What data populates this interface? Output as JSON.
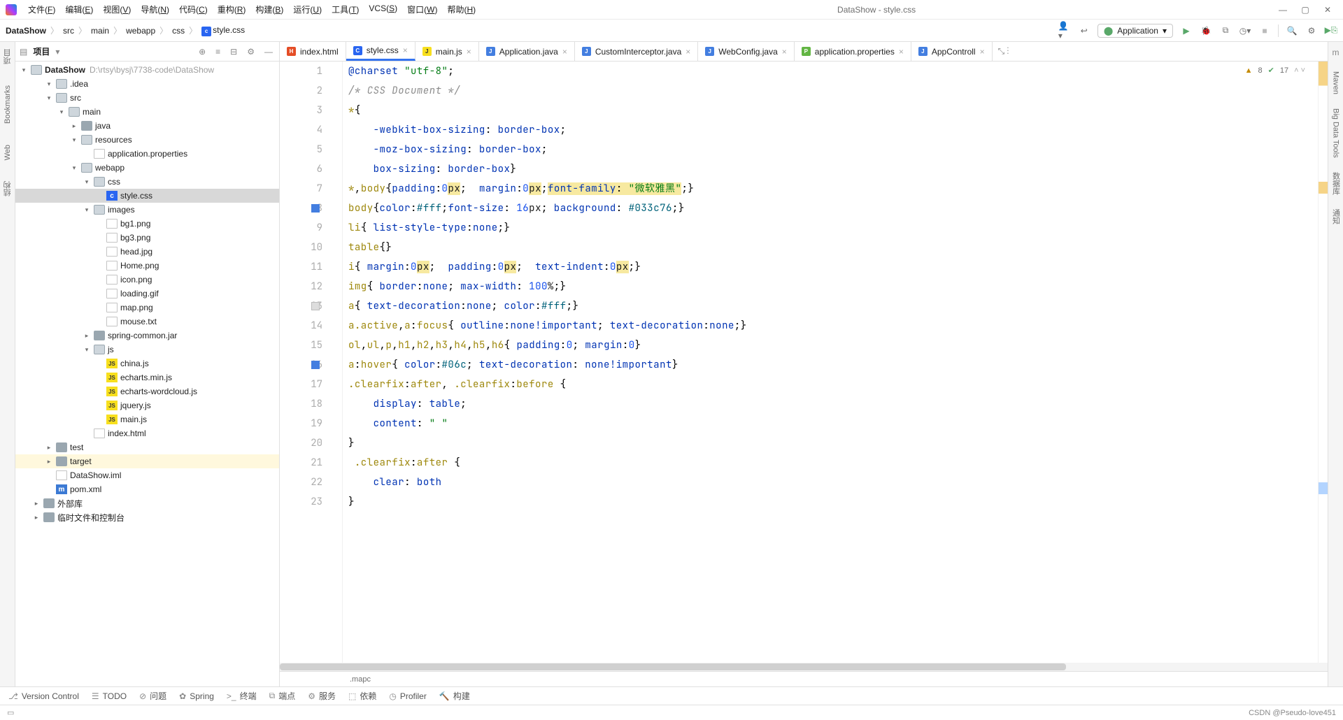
{
  "window": {
    "title": "DataShow - style.css"
  },
  "menus": [
    "文件(F)",
    "编辑(E)",
    "视图(V)",
    "导航(N)",
    "代码(C)",
    "重构(R)",
    "构建(B)",
    "运行(U)",
    "工具(T)",
    "VCS(S)",
    "窗口(W)",
    "帮助(H)"
  ],
  "breadcrumb": [
    "DataShow",
    "src",
    "main",
    "webapp",
    "css",
    "style.css"
  ],
  "run_config": "Application",
  "project_panel": {
    "title": "项目",
    "root": {
      "name": "DataShow",
      "path": "D:\\rtsy\\bysj\\7738-code\\DataShow"
    },
    "items": [
      {
        "d": 1,
        "t": "folder",
        "exp": true,
        "n": ".idea"
      },
      {
        "d": 1,
        "t": "folder",
        "exp": true,
        "n": "src"
      },
      {
        "d": 2,
        "t": "folder",
        "exp": true,
        "n": "main"
      },
      {
        "d": 3,
        "t": "folder",
        "exp": false,
        "n": "java"
      },
      {
        "d": 3,
        "t": "folder",
        "exp": true,
        "n": "resources"
      },
      {
        "d": 4,
        "t": "prop",
        "n": "application.properties"
      },
      {
        "d": 3,
        "t": "folder",
        "exp": true,
        "n": "webapp"
      },
      {
        "d": 4,
        "t": "folder",
        "exp": true,
        "n": "css"
      },
      {
        "d": 5,
        "t": "css",
        "n": "style.css",
        "sel": true
      },
      {
        "d": 4,
        "t": "folder",
        "exp": true,
        "n": "images"
      },
      {
        "d": 5,
        "t": "img",
        "n": "bg1.png"
      },
      {
        "d": 5,
        "t": "img",
        "n": "bg3.png"
      },
      {
        "d": 5,
        "t": "img",
        "n": "head.jpg"
      },
      {
        "d": 5,
        "t": "img",
        "n": "Home.png"
      },
      {
        "d": 5,
        "t": "img",
        "n": "icon.png"
      },
      {
        "d": 5,
        "t": "img",
        "n": "loading.gif"
      },
      {
        "d": 5,
        "t": "img",
        "n": "map.png"
      },
      {
        "d": 5,
        "t": "txt",
        "n": "mouse.txt"
      },
      {
        "d": 4,
        "t": "jar",
        "exp": false,
        "n": "spring-common.jar"
      },
      {
        "d": 4,
        "t": "folder",
        "exp": true,
        "n": "js"
      },
      {
        "d": 5,
        "t": "js",
        "n": "china.js"
      },
      {
        "d": 5,
        "t": "js",
        "n": "echarts.min.js"
      },
      {
        "d": 5,
        "t": "js",
        "n": "echarts-wordcloud.js"
      },
      {
        "d": 5,
        "t": "js",
        "n": "jquery.js"
      },
      {
        "d": 5,
        "t": "js",
        "n": "main.js"
      },
      {
        "d": 4,
        "t": "html",
        "n": "index.html"
      },
      {
        "d": 1,
        "t": "folder",
        "exp": false,
        "n": "test"
      },
      {
        "d": 1,
        "t": "folder",
        "exp": false,
        "n": "target",
        "hl": true
      },
      {
        "d": 1,
        "t": "iml",
        "n": "DataShow.iml"
      },
      {
        "d": 1,
        "t": "m",
        "n": "pom.xml"
      },
      {
        "d": 0,
        "t": "lib",
        "exp": false,
        "n": "外部库"
      },
      {
        "d": 0,
        "t": "scratch",
        "exp": false,
        "n": "临时文件和控制台"
      }
    ]
  },
  "tabs": [
    {
      "icon": "html",
      "label": "index.html"
    },
    {
      "icon": "css",
      "label": "style.css",
      "active": true,
      "close": true
    },
    {
      "icon": "js",
      "label": "main.js",
      "close": true
    },
    {
      "icon": "java",
      "label": "Application.java",
      "close": true
    },
    {
      "icon": "java",
      "label": "CustomInterceptor.java",
      "close": true
    },
    {
      "icon": "java",
      "label": "WebConfig.java",
      "close": true
    },
    {
      "icon": "prop",
      "label": "application.properties",
      "close": true
    },
    {
      "icon": "java",
      "label": "AppControll",
      "close": true
    }
  ],
  "inspections": {
    "warn_count": "8",
    "ok_count": "17"
  },
  "code_lines": [
    {
      "n": 1,
      "html": "<span class='k'>@charset</span> <span class='s'>\"utf-8\"</span><span class='p'>;</span>"
    },
    {
      "n": 2,
      "html": "<span class='c'>/* CSS Document */</span>"
    },
    {
      "n": 3,
      "html": "<span class='sel-y'>*</span><span class='p'>{</span>"
    },
    {
      "n": 4,
      "html": "    <span class='k'>-webkit-box-sizing</span><span class='p'>:</span> <span class='k'>border-box</span><span class='p'>;</span>"
    },
    {
      "n": 5,
      "html": "    <span class='k'>-moz-box-sizing</span><span class='p'>:</span> <span class='k'>border-box</span><span class='p'>;</span>"
    },
    {
      "n": 6,
      "html": "    <span class='k'>box-sizing</span><span class='p'>:</span> <span class='k'>border-box</span><span class='p'>}</span>"
    },
    {
      "n": 7,
      "html": "<span class='sel-y'>*</span><span class='p'>,</span><span class='sel-y'>body</span><span class='p'>{</span><span class='k'>padding</span><span class='p'>:</span><span class='n'>0</span><span class='hl-y'>px</span><span class='p'>;</span>  <span class='k'>margin</span><span class='p'>:</span><span class='n'>0</span><span class='hl-y'>px</span><span class='p'>;</span><span class='hl-y'><span class='k'>font-family</span><span class='p'>:</span> <span class='s'>\"微软雅黑\"</span></span><span class='p'>;}</span>"
    },
    {
      "n": 8,
      "mk": "blue",
      "html": "<span class='sel-y'>body</span><span class='p'>{</span><span class='k'>color</span><span class='p'>:</span><span class='fn'>#fff</span><span class='p'>;</span><span class='k'>font-size</span><span class='p'>:</span> <span class='n'>16</span>px<span class='p'>;</span> <span class='k'>background</span><span class='p'>:</span> <span class='fn'>#033c76</span><span class='p'>;}</span>"
    },
    {
      "n": 9,
      "html": "<span class='sel-y'>li</span><span class='p'>{</span> <span class='k'>list-style-type</span><span class='p'>:</span><span class='k'>none</span><span class='p'>;}</span>"
    },
    {
      "n": 10,
      "html": "<span class='sel-y'>table</span><span class='p'>{}</span>"
    },
    {
      "n": 11,
      "html": "<span class='sel-y'>i</span><span class='p'>{</span> <span class='k'>margin</span><span class='p'>:</span><span class='n'>0</span><span class='hl-y'>px</span><span class='p'>;</span>  <span class='k'>padding</span><span class='p'>:</span><span class='n'>0</span><span class='hl-y'>px</span><span class='p'>;</span>  <span class='k'>text-indent</span><span class='p'>:</span><span class='n'>0</span><span class='hl-y'>px</span><span class='p'>;}</span>"
    },
    {
      "n": 12,
      "html": "<span class='sel-y'>img</span><span class='p'>{</span> <span class='k'>border</span><span class='p'>:</span><span class='k'>none</span><span class='p'>;</span> <span class='k'>max-width</span><span class='p'>:</span> <span class='n'>100</span>%<span class='p'>;}</span>"
    },
    {
      "n": 13,
      "mk": "grey",
      "html": "<span class='sel-y'>a</span><span class='p'>{</span> <span class='k'>text-decoration</span><span class='p'>:</span><span class='k'>none</span><span class='p'>;</span> <span class='k'>color</span><span class='p'>:</span><span class='fn'>#fff</span><span class='p'>;}</span>"
    },
    {
      "n": 14,
      "html": "<span class='sel-y'>a.active</span><span class='p'>,</span><span class='sel-y'>a</span><span class='p'>:</span><span class='sel-y'>focus</span><span class='p'>{</span> <span class='k'>outline</span><span class='p'>:</span><span class='k'>none</span><span class='k'>!important</span><span class='p'>;</span> <span class='k'>text-decoration</span><span class='p'>:</span><span class='k'>none</span><span class='p'>;}</span>"
    },
    {
      "n": 15,
      "html": "<span class='sel-y'>ol</span><span class='p'>,</span><span class='sel-y'>ul</span><span class='p'>,</span><span class='sel-y'>p</span><span class='p'>,</span><span class='sel-y'>h1</span><span class='p'>,</span><span class='sel-y'>h2</span><span class='p'>,</span><span class='sel-y'>h3</span><span class='p'>,</span><span class='sel-y'>h4</span><span class='p'>,</span><span class='sel-y'>h5</span><span class='p'>,</span><span class='sel-y'>h6</span><span class='p'>{</span> <span class='k'>padding</span><span class='p'>:</span><span class='n'>0</span><span class='p'>;</span> <span class='k'>margin</span><span class='p'>:</span><span class='n'>0</span><span class='p'>}</span>"
    },
    {
      "n": 16,
      "mk": "blue",
      "html": "<span class='sel-y'>a</span><span class='p'>:</span><span class='sel-y'>hover</span><span class='p'>{</span> <span class='k'>color</span><span class='p'>:</span><span class='fn'>#06c</span><span class='p'>;</span> <span class='k'>text-decoration</span><span class='p'>:</span> <span class='k'>none</span><span class='k'>!important</span><span class='p'>}</span>"
    },
    {
      "n": 17,
      "html": "<span class='sel-y'>.clearfix</span><span class='p'>:</span><span class='sel-y'>after</span><span class='p'>,</span> <span class='sel-y'>.clearfix</span><span class='p'>:</span><span class='sel-y'>before</span> <span class='p'>{</span>"
    },
    {
      "n": 18,
      "html": "    <span class='k'>display</span><span class='p'>:</span> <span class='k'>table</span><span class='p'>;</span>"
    },
    {
      "n": 19,
      "html": "    <span class='k'>content</span><span class='p'>:</span> <span class='s'>\" \"</span>"
    },
    {
      "n": 20,
      "html": "<span class='p'>}</span>"
    },
    {
      "n": 21,
      "html": " <span class='sel-y'>.clearfix</span><span class='p'>:</span><span class='sel-y'>after</span> <span class='p'>{</span>"
    },
    {
      "n": 22,
      "html": "    <span class='k'>clear</span><span class='p'>:</span> <span class='k'>both</span>"
    },
    {
      "n": 23,
      "html": "<span class='p'>}</span>"
    }
  ],
  "editor_crumb": ".mapc",
  "right_rail": [
    "Maven",
    "Big Data Tools",
    "数据库",
    "通知"
  ],
  "left_rail": [
    "项目",
    "Bookmarks",
    "Web",
    "结构"
  ],
  "bottom_tools": [
    {
      "i": "⎇",
      "l": "Version Control"
    },
    {
      "i": "☰",
      "l": "TODO"
    },
    {
      "i": "⊘",
      "l": "问题"
    },
    {
      "i": "✿",
      "l": "Spring"
    },
    {
      "i": ">_",
      "l": "终端"
    },
    {
      "i": "⧉",
      "l": "端点"
    },
    {
      "i": "⚙",
      "l": "服务"
    },
    {
      "i": "⬚",
      "l": "依赖"
    },
    {
      "i": "◷",
      "l": "Profiler"
    },
    {
      "i": "🔨",
      "l": "构建"
    }
  ],
  "status_right": "CSDN @Pseudo-love451"
}
